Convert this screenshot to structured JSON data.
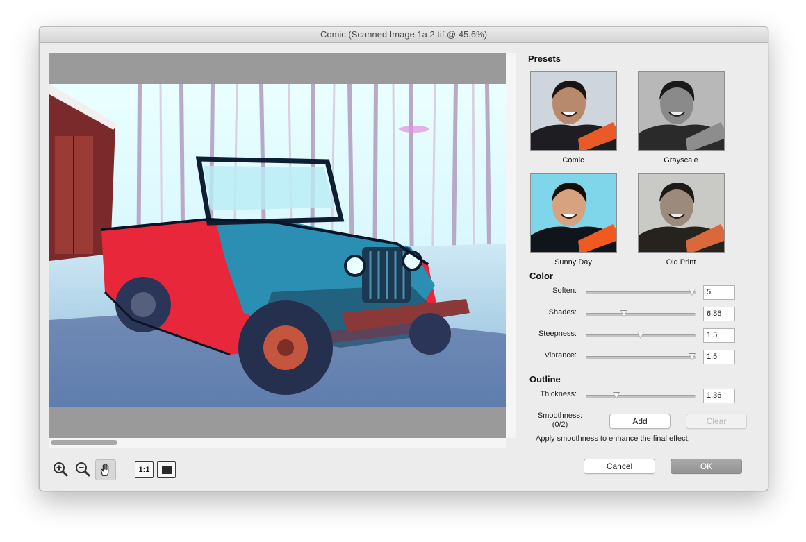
{
  "window": {
    "title": "Comic (Scanned Image 1a 2.tif @ 45.6%)"
  },
  "presets": {
    "title": "Presets",
    "items": [
      {
        "label": "Comic"
      },
      {
        "label": "Grayscale"
      },
      {
        "label": "Sunny Day"
      },
      {
        "label": "Old Print"
      }
    ]
  },
  "color": {
    "title": "Color",
    "params": [
      {
        "label": "Soften:",
        "value": "5",
        "level": 0.97
      },
      {
        "label": "Shades:",
        "value": "6.86",
        "level": 0.35
      },
      {
        "label": "Steepness:",
        "value": "1.5",
        "level": 0.5
      },
      {
        "label": "Vibrance:",
        "value": "1.5",
        "level": 0.97
      }
    ]
  },
  "outline": {
    "title": "Outline",
    "thickness": {
      "label": "Thickness:",
      "value": "1.36",
      "level": 0.28
    },
    "smoothness": {
      "label": "Smoothness:",
      "count": "(0/2)",
      "add_label": "Add",
      "clear_label": "Clear",
      "hint": "Apply smoothness to enhance the final effect."
    }
  },
  "toolbar": {
    "actual_size_label": "1:1",
    "tools": [
      "zoom-in-icon",
      "zoom-out-icon",
      "hand-icon",
      "actual-size-icon",
      "fit-to-window-icon"
    ]
  },
  "buttons": {
    "cancel_label": "Cancel",
    "ok_label": "OK"
  },
  "colors": {
    "accent": "#9b9b9b",
    "jeep_body": "#e8283a",
    "jeep_hood": "#2b8fb3"
  }
}
